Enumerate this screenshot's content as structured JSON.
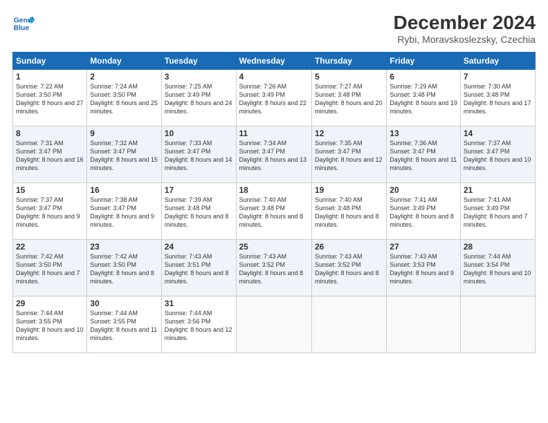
{
  "logo": {
    "line1": "General",
    "line2": "Blue"
  },
  "title": "December 2024",
  "location": "Rybi, Moravskoslezsky, Czechia",
  "days_of_week": [
    "Sunday",
    "Monday",
    "Tuesday",
    "Wednesday",
    "Thursday",
    "Friday",
    "Saturday"
  ],
  "weeks": [
    [
      {
        "day": "1",
        "sunrise": "7:22 AM",
        "sunset": "3:50 PM",
        "daylight": "8 hours and 27 minutes."
      },
      {
        "day": "2",
        "sunrise": "7:24 AM",
        "sunset": "3:50 PM",
        "daylight": "8 hours and 25 minutes."
      },
      {
        "day": "3",
        "sunrise": "7:25 AM",
        "sunset": "3:49 PM",
        "daylight": "8 hours and 24 minutes."
      },
      {
        "day": "4",
        "sunrise": "7:26 AM",
        "sunset": "3:49 PM",
        "daylight": "8 hours and 22 minutes."
      },
      {
        "day": "5",
        "sunrise": "7:27 AM",
        "sunset": "3:48 PM",
        "daylight": "8 hours and 20 minutes."
      },
      {
        "day": "6",
        "sunrise": "7:29 AM",
        "sunset": "3:48 PM",
        "daylight": "8 hours and 19 minutes."
      },
      {
        "day": "7",
        "sunrise": "7:30 AM",
        "sunset": "3:48 PM",
        "daylight": "8 hours and 17 minutes."
      }
    ],
    [
      {
        "day": "8",
        "sunrise": "7:31 AM",
        "sunset": "3:47 PM",
        "daylight": "8 hours and 16 minutes."
      },
      {
        "day": "9",
        "sunrise": "7:32 AM",
        "sunset": "3:47 PM",
        "daylight": "8 hours and 15 minutes."
      },
      {
        "day": "10",
        "sunrise": "7:33 AM",
        "sunset": "3:47 PM",
        "daylight": "8 hours and 14 minutes."
      },
      {
        "day": "11",
        "sunrise": "7:34 AM",
        "sunset": "3:47 PM",
        "daylight": "8 hours and 13 minutes."
      },
      {
        "day": "12",
        "sunrise": "7:35 AM",
        "sunset": "3:47 PM",
        "daylight": "8 hours and 12 minutes."
      },
      {
        "day": "13",
        "sunrise": "7:36 AM",
        "sunset": "3:47 PM",
        "daylight": "8 hours and 11 minutes."
      },
      {
        "day": "14",
        "sunrise": "7:37 AM",
        "sunset": "3:47 PM",
        "daylight": "8 hours and 10 minutes."
      }
    ],
    [
      {
        "day": "15",
        "sunrise": "7:37 AM",
        "sunset": "3:47 PM",
        "daylight": "8 hours and 9 minutes."
      },
      {
        "day": "16",
        "sunrise": "7:38 AM",
        "sunset": "3:47 PM",
        "daylight": "8 hours and 9 minutes."
      },
      {
        "day": "17",
        "sunrise": "7:39 AM",
        "sunset": "3:48 PM",
        "daylight": "8 hours and 8 minutes."
      },
      {
        "day": "18",
        "sunrise": "7:40 AM",
        "sunset": "3:48 PM",
        "daylight": "8 hours and 8 minutes."
      },
      {
        "day": "19",
        "sunrise": "7:40 AM",
        "sunset": "3:48 PM",
        "daylight": "8 hours and 8 minutes."
      },
      {
        "day": "20",
        "sunrise": "7:41 AM",
        "sunset": "3:49 PM",
        "daylight": "8 hours and 8 minutes."
      },
      {
        "day": "21",
        "sunrise": "7:41 AM",
        "sunset": "3:49 PM",
        "daylight": "8 hours and 7 minutes."
      }
    ],
    [
      {
        "day": "22",
        "sunrise": "7:42 AM",
        "sunset": "3:50 PM",
        "daylight": "8 hours and 7 minutes."
      },
      {
        "day": "23",
        "sunrise": "7:42 AM",
        "sunset": "3:50 PM",
        "daylight": "8 hours and 8 minutes."
      },
      {
        "day": "24",
        "sunrise": "7:43 AM",
        "sunset": "3:51 PM",
        "daylight": "8 hours and 8 minutes."
      },
      {
        "day": "25",
        "sunrise": "7:43 AM",
        "sunset": "3:52 PM",
        "daylight": "8 hours and 8 minutes."
      },
      {
        "day": "26",
        "sunrise": "7:43 AM",
        "sunset": "3:52 PM",
        "daylight": "8 hours and 8 minutes."
      },
      {
        "day": "27",
        "sunrise": "7:43 AM",
        "sunset": "3:53 PM",
        "daylight": "8 hours and 9 minutes."
      },
      {
        "day": "28",
        "sunrise": "7:44 AM",
        "sunset": "3:54 PM",
        "daylight": "8 hours and 10 minutes."
      }
    ],
    [
      {
        "day": "29",
        "sunrise": "7:44 AM",
        "sunset": "3:55 PM",
        "daylight": "8 hours and 10 minutes."
      },
      {
        "day": "30",
        "sunrise": "7:44 AM",
        "sunset": "3:55 PM",
        "daylight": "8 hours and 11 minutes."
      },
      {
        "day": "31",
        "sunrise": "7:44 AM",
        "sunset": "3:56 PM",
        "daylight": "8 hours and 12 minutes."
      },
      null,
      null,
      null,
      null
    ]
  ]
}
